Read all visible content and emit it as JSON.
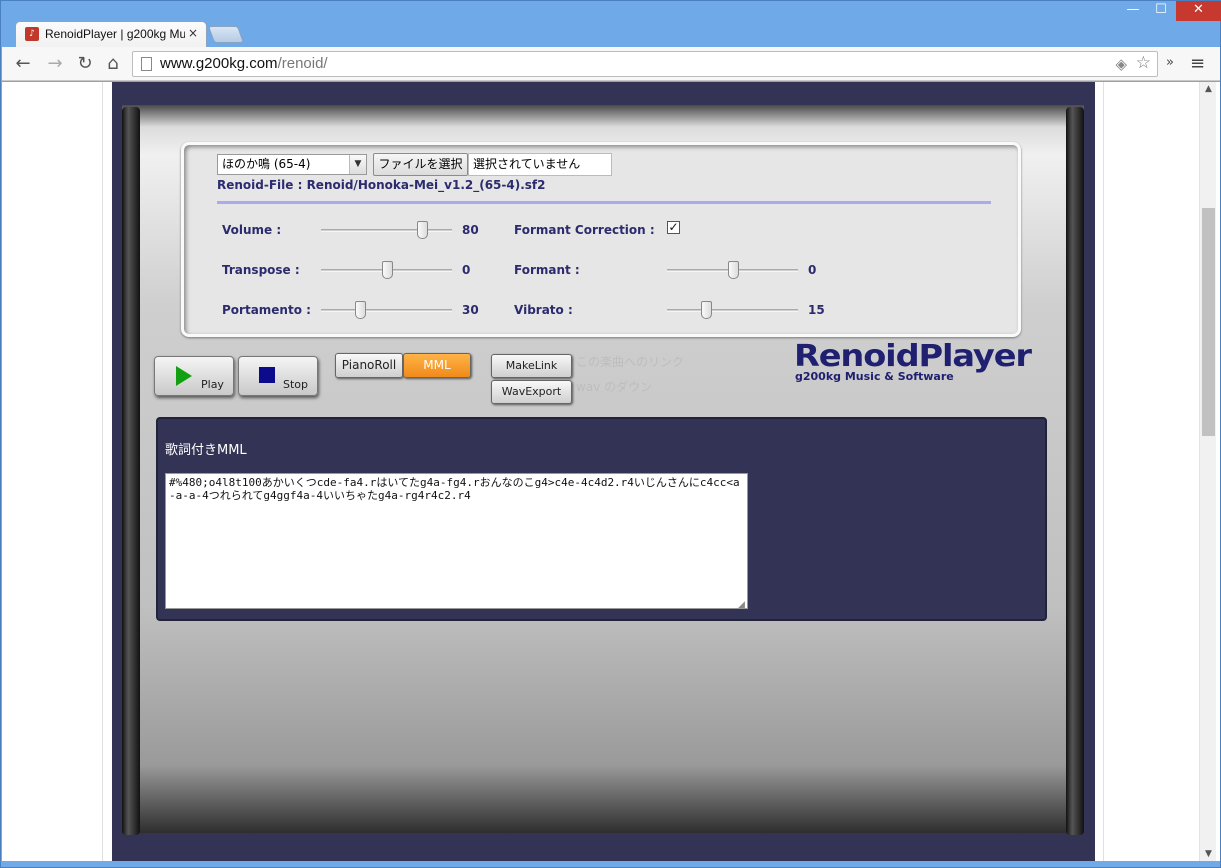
{
  "browser": {
    "tab_title": "RenoidPlayer | g200kg Mu",
    "tab_close": "×",
    "url_host": "www.g200kg.com",
    "url_path": "/renoid/",
    "window_controls": {
      "minimize": "—",
      "maximize": "☐",
      "close": "✕"
    },
    "nav": {
      "back": "←",
      "forward": "→",
      "reload": "↻",
      "home": "⌂"
    },
    "overflow": "»",
    "menu": "≡"
  },
  "panel": {
    "voice_select": "ほのか鳴 (65-4)",
    "file_button": "ファイルを選択",
    "file_status": "選択されていません",
    "renoid_file": "Renoid-File : Renoid/Honoka-Mei_v1.2_(65-4).sf2",
    "params": {
      "volume": {
        "label": "Volume :",
        "value": "80",
        "level": 0.77
      },
      "transpose": {
        "label": "Transpose :",
        "value": "0",
        "level": 0.5
      },
      "portamento": {
        "label": "Portamento :",
        "value": "30",
        "level": 0.3
      },
      "formant_correction": {
        "label": "Formant Correction :",
        "checked": true,
        "check_mark": "✓"
      },
      "formant": {
        "label": "Formant :",
        "value": "0",
        "level": 0.5
      },
      "vibrato": {
        "label": "Vibrato :",
        "value": "15",
        "level": 0.3
      }
    }
  },
  "controls": {
    "play_label": "Play",
    "stop_label": "Stop",
    "pianoroll_label": "PianoRoll",
    "mml_label": "MML",
    "active_mode": "MML",
    "makelink_label": "MakeLink",
    "wavexport_label": "WavExport",
    "faint_1": "この楽曲へのリンク",
    "faint_2": "wav のダウン"
  },
  "logo": {
    "title": "RenoidPlayer",
    "subtitle": "g200kg Music & Software"
  },
  "mml": {
    "heading": "歌詞付きMML",
    "text": "#%480;o4l8t100あかいくつcde-fa4.rはいてたg4a-fg4.rおんなのこg4>c4e-4c4d2.r4いじんさんにc4cc<a-a-a-4つれられてg4ggf4a-4いいちゃたg4a-rg4r4c2.r4"
  },
  "colors": {
    "accent_orange": "#f08a1a",
    "label_navy": "#2b2b6e",
    "panel_dark": "#333355",
    "play_green": "#12a012",
    "stop_blue": "#0b0b8c"
  }
}
